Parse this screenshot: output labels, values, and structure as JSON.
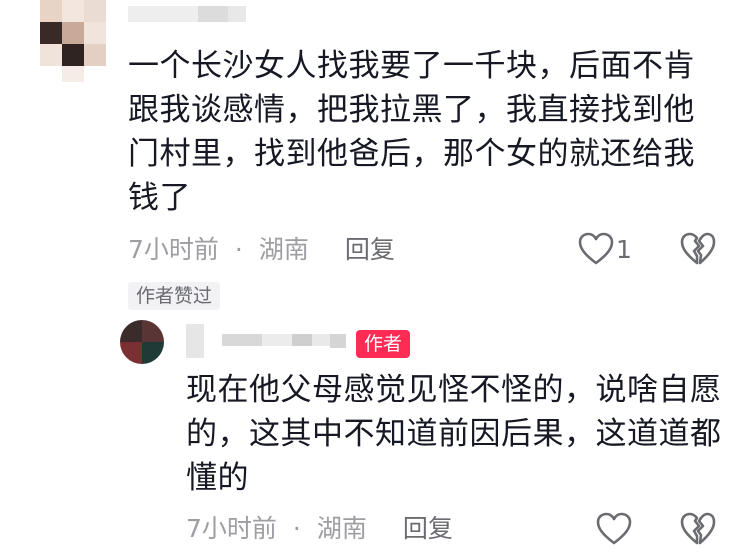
{
  "comment": {
    "text": "一个长沙女人找我要了一千块，后面不肯跟我谈感情，把我拉黑了，我直接找到他门村里，找到他爸后，那个女的就还给我钱了",
    "time": "7小时前",
    "location": "湖南",
    "reply_label": "回复",
    "like_count": "1",
    "author_liked_tag": "作者赞过"
  },
  "reply": {
    "author_badge": "作者",
    "text": "现在他父母感觉见怪不怪的，说啥自愿的，这其中不知道前因后果，这道道都懂的",
    "time": "7小时前",
    "location": "湖南",
    "reply_label": "回复"
  },
  "icons": {
    "like": "heart-outline-icon",
    "dislike": "broken-heart-icon"
  },
  "colors": {
    "badge": "#fe2c55",
    "meta_text": "#9d9ea3",
    "body_text": "#161823"
  }
}
